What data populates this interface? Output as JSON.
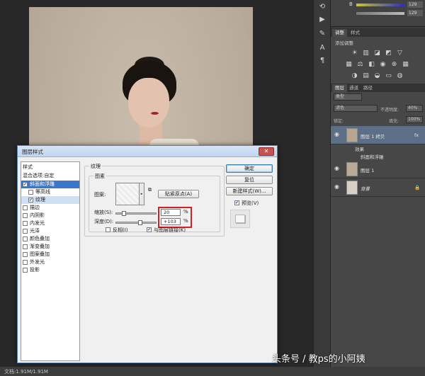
{
  "status_bar": {
    "doc_size": "文档:1.91M/1.91M"
  },
  "color_panel": {
    "channels": [
      {
        "label": "B",
        "value": "129"
      },
      {
        "label": "",
        "value": "129"
      }
    ]
  },
  "adjustments_panel": {
    "tabs": [
      "调整",
      "样式"
    ],
    "title": "添加调整"
  },
  "layers_panel": {
    "tabs": [
      "图层",
      "通道",
      "路径"
    ],
    "kind_filter": "类型",
    "blend_mode": "滤色",
    "opacity_label": "不透明度:",
    "opacity_value": "40%",
    "lock_label": "锁定:",
    "fill_label": "填充:",
    "fill_value": "100%",
    "layers": [
      {
        "name": "图层 1 拷贝",
        "fx": "fx",
        "selected": true
      },
      {
        "name": "图层 1",
        "fx": "",
        "selected": false
      },
      {
        "name": "背景",
        "fx": "",
        "selected": false
      }
    ],
    "effects_label": "效果",
    "effect_item": "斜面和浮雕"
  },
  "dialog": {
    "title": "图层样式",
    "close_label": "✕",
    "styles_header": "样式",
    "blend_options": "混合选项:自定",
    "style_items": [
      {
        "label": "斜面和浮雕",
        "checked": true,
        "selected": true,
        "indent": false
      },
      {
        "label": "等高线",
        "checked": false,
        "selected": false,
        "indent": true
      },
      {
        "label": "纹理",
        "checked": true,
        "selected": false,
        "indent": true,
        "hover": true
      },
      {
        "label": "描边",
        "checked": false,
        "selected": false,
        "indent": false
      },
      {
        "label": "内阴影",
        "checked": false,
        "selected": false,
        "indent": false
      },
      {
        "label": "内发光",
        "checked": false,
        "selected": false,
        "indent": false
      },
      {
        "label": "光泽",
        "checked": false,
        "selected": false,
        "indent": false
      },
      {
        "label": "颜色叠加",
        "checked": false,
        "selected": false,
        "indent": false
      },
      {
        "label": "渐变叠加",
        "checked": false,
        "selected": false,
        "indent": false
      },
      {
        "label": "图案叠加",
        "checked": false,
        "selected": false,
        "indent": false
      },
      {
        "label": "外发光",
        "checked": false,
        "selected": false,
        "indent": false
      },
      {
        "label": "投影",
        "checked": false,
        "selected": false,
        "indent": false
      }
    ],
    "texture": {
      "group_title": "纹理",
      "subgroup_title": "图素",
      "pattern_label": "图案:",
      "snap_origin": "贴紧原点(A)",
      "scale_label": "缩放(S):",
      "scale_value": "20",
      "scale_fraction": 0.2,
      "depth_label": "深度(D):",
      "depth_value": "+103",
      "depth_fraction": 0.6,
      "percent": "%",
      "invert_label": "反相(I)",
      "link_label": "与图层链接(K)",
      "link_checked": true
    },
    "buttons": {
      "ok": "确定",
      "reset": "复位",
      "new_style": "新建样式(W)...",
      "preview_label": "预览(V)",
      "preview_checked": true
    }
  },
  "watermark": "头条号 / 教ps的小阿姨"
}
